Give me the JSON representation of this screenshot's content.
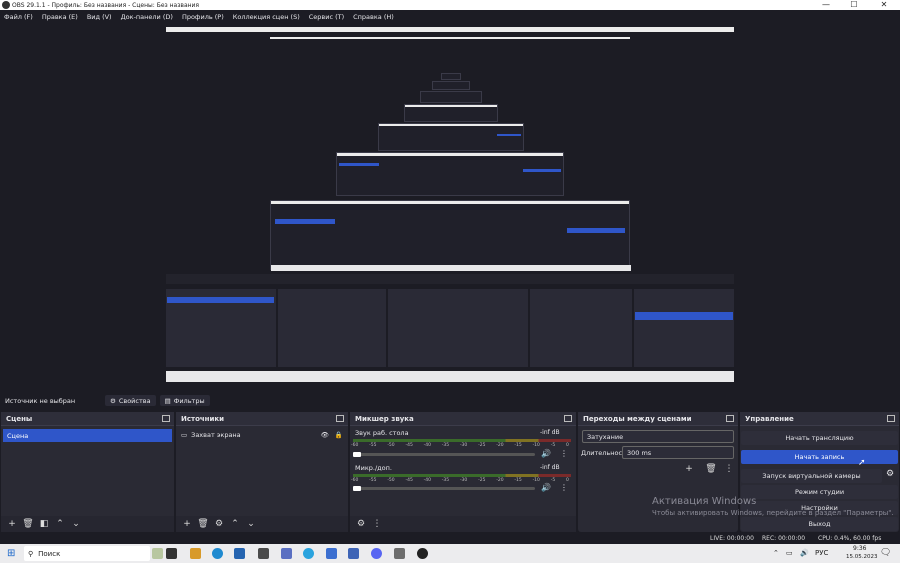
{
  "window": {
    "title": "OBS 29.1.1 - Профиль: Без названия - Сцены: Без названия",
    "minimize": "—",
    "maximize": "☐",
    "close": "✕"
  },
  "menu": [
    "Файл (F)",
    "Правка (E)",
    "Вид (V)",
    "Док-панели (D)",
    "Профиль (P)",
    "Коллекция сцен (S)",
    "Сервис (T)",
    "Справка (H)"
  ],
  "source_bar": {
    "no_source": "Источник не выбран",
    "properties": "Свойства",
    "filters": "Фильтры"
  },
  "scenes": {
    "title": "Сцены",
    "items": [
      "Сцена"
    ]
  },
  "sources": {
    "title": "Источники",
    "items": [
      "Захват экрана"
    ]
  },
  "mixer": {
    "title": "Микшер звука",
    "channels": [
      {
        "name": "Звук раб. стола",
        "level": "-inf dB"
      },
      {
        "name": "Микр./доп.",
        "level": "-inf dB"
      }
    ],
    "ticks": [
      "-60",
      "-55",
      "-50",
      "-45",
      "-40",
      "-35",
      "-30",
      "-25",
      "-20",
      "-15",
      "-10",
      "-5",
      "0"
    ]
  },
  "transitions": {
    "title": "Переходы между сценами",
    "type": "Затухание",
    "duration_label": "Длительность",
    "duration_value": "300 ms"
  },
  "controls": {
    "title": "Управление",
    "buttons": [
      "Начать трансляцию",
      "Начать запись",
      "Запуск виртуальной камеры",
      "Режим студии",
      "Настройки",
      "Выход"
    ]
  },
  "watermark": {
    "line1": "Активация Windows",
    "line2": "Чтобы активировать Windows, перейдите в раздел \"Параметры\"."
  },
  "status": {
    "live": "LIVE: 00:00:00",
    "rec": "REC: 00:00:00",
    "cpu": "CPU: 0.4%, 60.00 fps"
  },
  "taskbar": {
    "search": "Поиск",
    "lang": "РУС",
    "time": "9:36",
    "date": "15.05.2023"
  },
  "colors": {
    "accent": "#2f56c9",
    "background": "#1c1c24",
    "panel": "#2a2a34"
  }
}
